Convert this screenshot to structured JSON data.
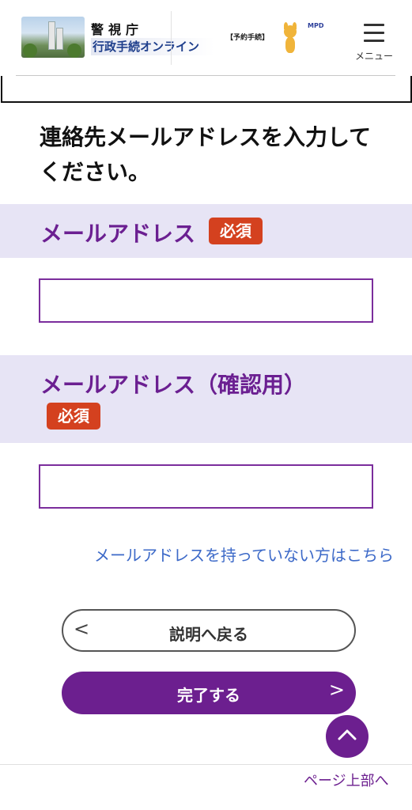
{
  "header": {
    "agency_name": "警視庁",
    "site_name": "行政手続オンライン",
    "reserve_tag": "【予約手続】",
    "mpd_logo_text": "MPD",
    "menu_icon": "hamburger-menu-icon",
    "menu_label": "メニュー"
  },
  "main": {
    "intro": "連絡先メールアドレスを入力してください。",
    "required_label": "必須",
    "email_field": {
      "title": "メールアドレス",
      "value": "",
      "placeholder": ""
    },
    "email_confirm_field": {
      "title": "メールアドレス（確認用）",
      "value": "",
      "placeholder": ""
    },
    "no_email_link": "メールアドレスを持っていない方はこちら",
    "back_button": {
      "arrow": "<",
      "label": "説明へ戻る"
    },
    "done_button": {
      "label": "完了する",
      "arrow": ">"
    }
  },
  "footer": {
    "to_top_icon": "chevron-up-icon",
    "to_top_label": "ページ上部へ"
  },
  "colors": {
    "accent_purple": "#6c1f8f",
    "field_title_purple": "#6b1f91",
    "band_lavender": "#e7e4f5",
    "required_red": "#d4411f",
    "link_blue": "#3c69c8"
  }
}
